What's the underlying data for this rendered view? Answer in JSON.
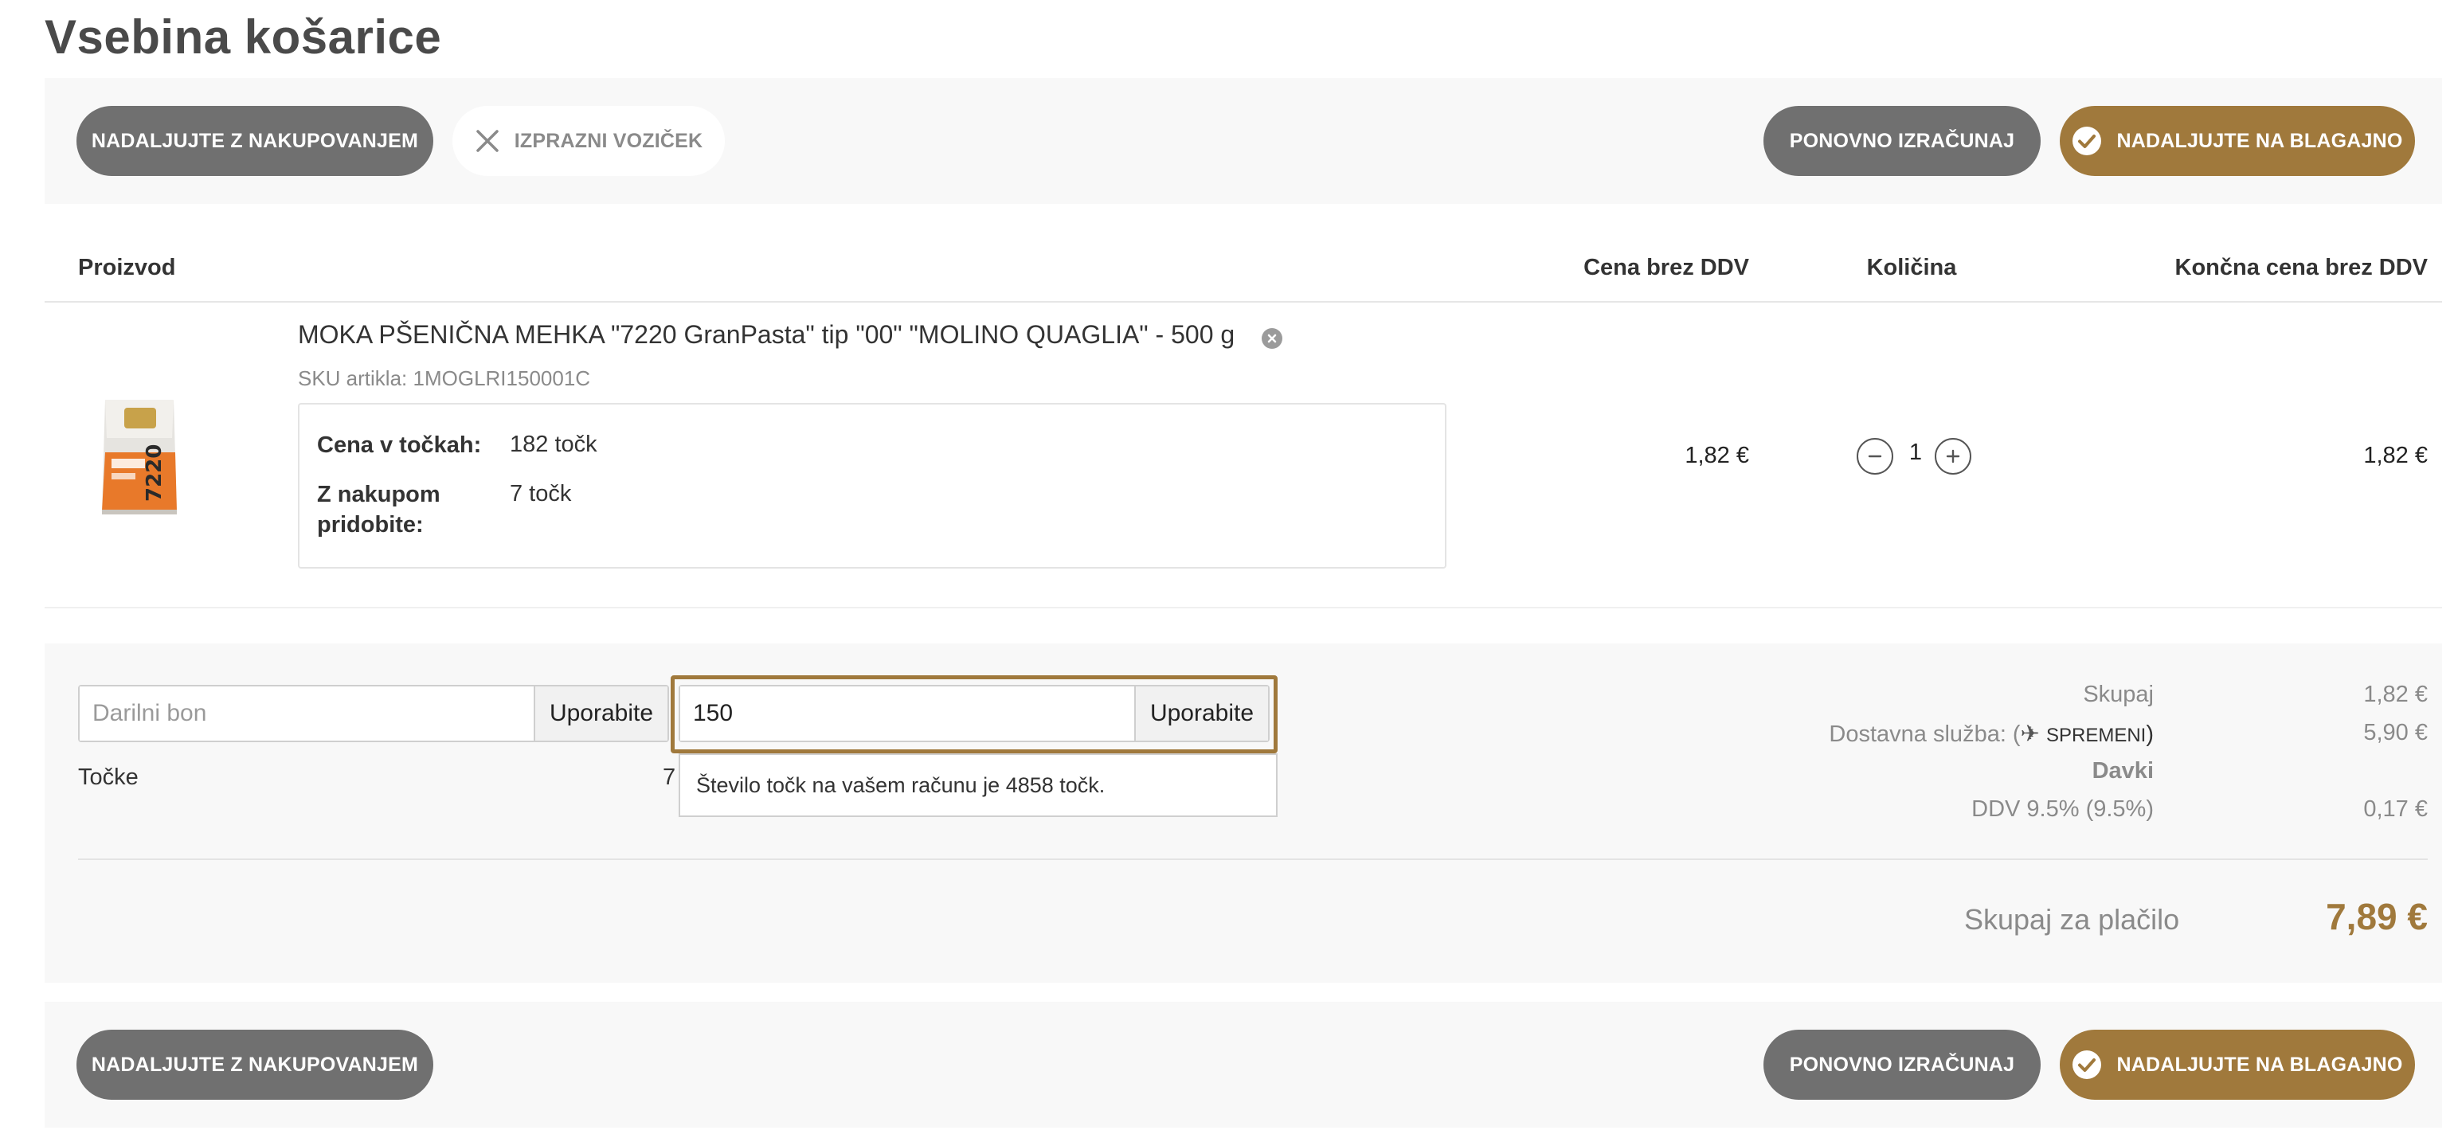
{
  "page": {
    "title": "Vsebina košarice"
  },
  "toolbar": {
    "continue_shopping": "NADALJUJTE Z NAKUPOVANJEM",
    "empty_cart": "IZPRAZNI VOZIČEK",
    "recalculate": "PONOVNO IZRAČUNAJ",
    "checkout": "NADALJUJTE NA BLAGAJNO"
  },
  "table": {
    "headers": {
      "product": "Proizvod",
      "price": "Cena brez DDV",
      "quantity": "Količina",
      "total": "Končna cena brez DDV"
    }
  },
  "item": {
    "name": "MOKA PŠENIČNA MEHKA \"7220 GranPasta\" tip \"00\" \"MOLINO QUAGLIA\" - 500 g",
    "sku_label": "SKU artikla:",
    "sku": "1MOGLRI150001C",
    "points_price_label": "Cena v točkah:",
    "points_price": "182 točk",
    "points_earned_label": "Z nakupom pridobite:",
    "points_earned": "7 točk",
    "price": "1,82 €",
    "quantity": "1",
    "total": "1,82 €",
    "image_label": "7220"
  },
  "coupon": {
    "placeholder": "Darilni bon",
    "apply_label": "Uporabite"
  },
  "points": {
    "label": "Točke",
    "value_partial": "7",
    "input_value": "150",
    "apply_label": "Uporabite",
    "tooltip": "Število točk na vašem računu je 4858 točk."
  },
  "summary": {
    "subtotal_label": "Skupaj",
    "subtotal": "1,82 €",
    "shipping_label_prefix": "Dostavna služba: (",
    "shipping_change": "SPREMENI",
    "shipping_label_suffix": ")",
    "shipping": "5,90 €",
    "taxes_label": "Davki",
    "vat_label": "DDV 9.5% (9.5%)",
    "vat": "0,17 €",
    "grand_total_label": "Skupaj za plačilo",
    "grand_total": "7,89 €"
  },
  "colors": {
    "accent": "#a0793c",
    "button_gray": "#707070",
    "bar_bg": "#f8f8f8"
  }
}
